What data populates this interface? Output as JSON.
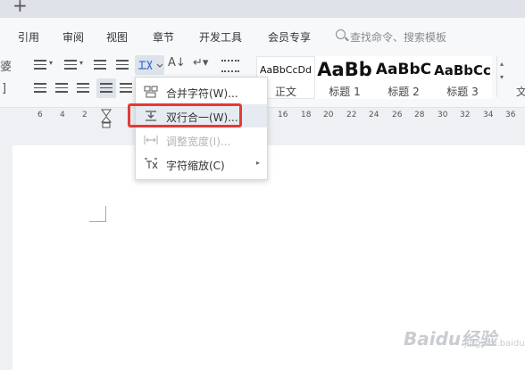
{
  "tabstrip": {
    "new_tab": "+"
  },
  "menu": {
    "items": [
      "引用",
      "审阅",
      "视图",
      "章节",
      "开发工具",
      "会员专享"
    ],
    "search_placeholder": "查找命令、搜索模板"
  },
  "ribbon": {
    "left_clip_top": "婆",
    "left_clip_bottom": "]",
    "font_size_glyph": "A↓",
    "right_clip": "文"
  },
  "styles": [
    {
      "preview": "AaBbCcDd",
      "name": "正文"
    },
    {
      "preview": "AaBb",
      "name": "标题 1"
    },
    {
      "preview": "AaBbC",
      "name": "标题 2"
    },
    {
      "preview": "AaBbCc",
      "name": "标题 3"
    }
  ],
  "ruler": {
    "left_ticks": [
      "6",
      "4",
      "2"
    ],
    "right_ticks": [
      "16",
      "18",
      "20",
      "22",
      "24",
      "26",
      "28",
      "30",
      "32",
      "34",
      "36"
    ]
  },
  "dropdown": {
    "items": [
      {
        "label": "合并字符(W)...",
        "icon": "merge-chars-icon",
        "enabled": true
      },
      {
        "label": "双行合一(W)...",
        "icon": "two-lines-in-one-icon",
        "enabled": true,
        "highlighted": true
      },
      {
        "label": "调整宽度(I)...",
        "icon": "adjust-width-icon",
        "enabled": false
      },
      {
        "label": "字符缩放(C)",
        "icon": "char-scale-icon",
        "enabled": true,
        "submenu": true
      }
    ],
    "submenu_arrow": "▸"
  },
  "watermark": {
    "brand": "Baidu经验",
    "sub": "jingyan.baidu.com"
  },
  "colors": {
    "highlight": "#e53935",
    "accent": "#3a6fd8"
  }
}
